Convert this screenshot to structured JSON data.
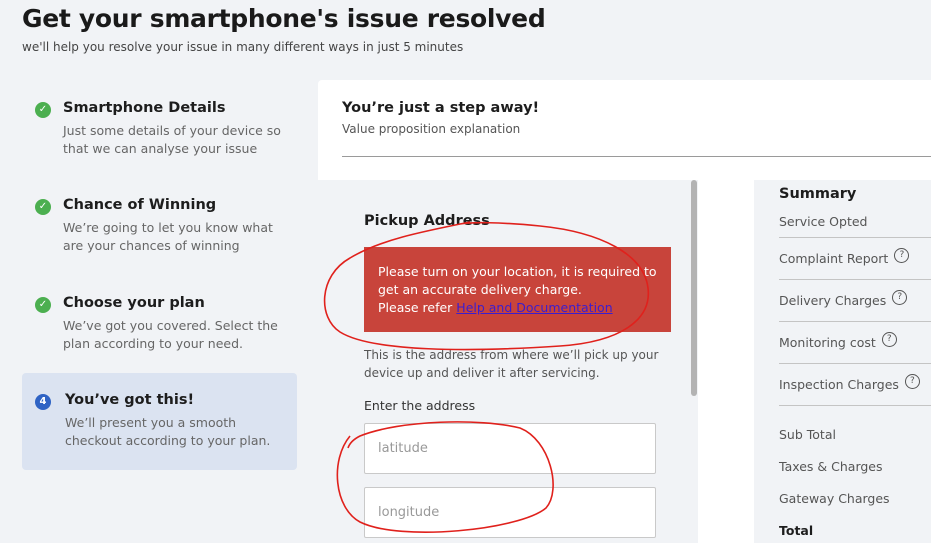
{
  "page": {
    "title": "Get your smartphone's issue resolved",
    "subtitle": "we'll help you resolve your issue in many different ways in just 5 minutes"
  },
  "steps": [
    {
      "number": "",
      "title": "Smartphone Details",
      "desc": "Just some details of your device so that we can analyse your issue",
      "status": "done"
    },
    {
      "number": "",
      "title": "Chance of Winning",
      "desc": "We’re going to let you know what are your chances of winning",
      "status": "done"
    },
    {
      "number": "",
      "title": "Choose your plan",
      "desc": "We’ve got you covered. Select the plan according to your need.",
      "status": "done"
    },
    {
      "number": "4",
      "title": "You’ve got this!",
      "desc": "We’ll present you a smooth checkout according to your plan.",
      "status": "active"
    }
  ],
  "card": {
    "title": "You’re just a step away!",
    "subtitle": "Value proposition explanation"
  },
  "pickup": {
    "heading": "Pickup Address",
    "alert_line1": "Please turn on your location, it is required to get an accurate delivery charge.",
    "alert_refer": "Please refer ",
    "alert_link": "Help and Documentation",
    "description": "This is the address from where we’ll pick up your device up and deliver it after servicing.",
    "field_label": "Enter the address",
    "latitude_placeholder": "latitude",
    "longitude_placeholder": "longitude"
  },
  "summary": {
    "title": "Summary",
    "rows": [
      {
        "label": "Service Opted",
        "help": false
      },
      {
        "label": "Complaint Report",
        "help": true
      },
      {
        "label": "Delivery Charges",
        "help": true
      },
      {
        "label": "Monitoring cost",
        "help": true
      },
      {
        "label": "Inspection Charges",
        "help": true
      },
      {
        "label": "Sub Total",
        "help": false
      },
      {
        "label": "Taxes & Charges",
        "help": false
      },
      {
        "label": "Gateway Charges",
        "help": false
      },
      {
        "label": "Total",
        "help": false
      }
    ],
    "help_glyph": "?"
  },
  "icons": {
    "check": "✓",
    "step_done": "check-circle-icon",
    "help": "question-circle-icon"
  },
  "colors": {
    "success": "#4caf50",
    "active_step": "#2f63c4",
    "alert_bg": "#c8443b",
    "link": "#3b1dcf",
    "annotation": "#e0211c"
  }
}
